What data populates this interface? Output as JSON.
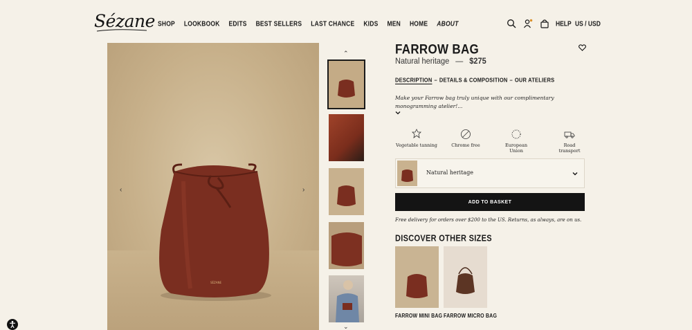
{
  "header": {
    "logo": "Sézane",
    "nav": [
      "SHOP",
      "LOOKBOOK",
      "EDITS",
      "BEST SELLERS",
      "LAST CHANCE",
      "KIDS",
      "MEN",
      "HOME",
      "ABOUT"
    ],
    "help": "HELP",
    "locale": "US / USD",
    "icons": [
      "search-icon",
      "account-icon",
      "basket-icon"
    ]
  },
  "gallery": {
    "thumbnails_count": 5,
    "active_thumbnail": 1
  },
  "product": {
    "title": "FARROW BAG",
    "variant": "Natural heritage",
    "separator": "—",
    "price": "$275",
    "tabs": [
      "DESCRIPTION",
      "–",
      "DETAILS & COMPOSITION",
      "–",
      "OUR ATELIERS"
    ],
    "description": "Make your Farrow bag truly unique with our complimentary monogramming atelier!...",
    "features": [
      "Vegetable tanning",
      "Chrome free",
      "European Union",
      "Road transport"
    ],
    "selected_color": "Natural heritage",
    "add_to_basket": "ADD TO BASKET",
    "delivery_note": "Free delivery for orders over $200 to the US. Returns, as always, are on us."
  },
  "other_sizes": {
    "title": "DISCOVER OTHER SIZES",
    "items": [
      {
        "label": "FARROW MINI BAG"
      },
      {
        "label": "FARROW MICRO BAG"
      }
    ]
  },
  "colors": {
    "background": "#f5f1e8",
    "ink": "#141414",
    "leather": "#7a2e20",
    "account_dot": "#d9902a"
  }
}
